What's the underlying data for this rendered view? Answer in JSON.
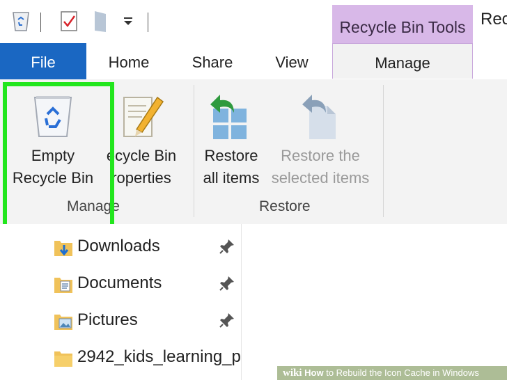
{
  "window": {
    "title": "Rec"
  },
  "tools_header": {
    "label": "Recycle Bin Tools"
  },
  "tabs": {
    "file": "File",
    "home": "Home",
    "share": "Share",
    "view": "View",
    "manage": "Manage"
  },
  "ribbon": {
    "empty": {
      "line1": "Empty",
      "line2": "Recycle Bin"
    },
    "properties": {
      "line1": "ecycle Bin",
      "line2": "roperties"
    },
    "manage_group": "Manage",
    "restore_all": {
      "line1": "Restore",
      "line2": "all items"
    },
    "restore_selected": {
      "line1": "Restore the",
      "line2": "selected items"
    },
    "restore_group": "Restore"
  },
  "nav": {
    "items": [
      {
        "label": "Downloads",
        "icon": "downloads-folder-icon"
      },
      {
        "label": "Documents",
        "icon": "documents-folder-icon"
      },
      {
        "label": "Pictures",
        "icon": "pictures-folder-icon"
      },
      {
        "label": "2942_kids_learning_p",
        "icon": "folder-icon"
      }
    ]
  },
  "watermark": {
    "brand": "wiki",
    "how": "How",
    "rest": " to Rebuild the Icon Cache in Windows"
  },
  "colors": {
    "file_tab": "#1a67c2",
    "tools_header": "#d8b8e8",
    "highlight": "#22e61d",
    "ribbon_bg": "#f3f3f3"
  }
}
